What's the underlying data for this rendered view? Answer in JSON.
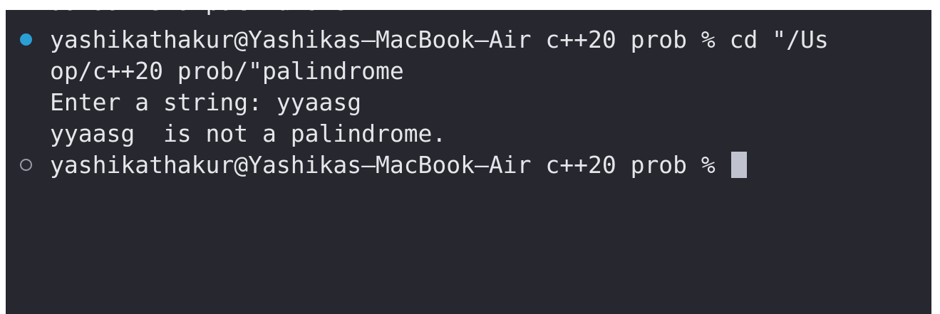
{
  "terminal": {
    "colors": {
      "background": "#272730",
      "text": "#e6e6ea",
      "success_dot": "#2a9fd6",
      "pending_dot": "#9a9aa6",
      "cursor": "#c0c3cf"
    },
    "partial_line": "aaiaa is a palindrome.",
    "lines": [
      {
        "status_icon": "filled-circle-icon",
        "text": "yashikathakur@Yashikas–MacBook–Air c++20 prob % cd \"/Us"
      },
      {
        "text": "op/c++20 prob/\"palindrome"
      },
      {
        "text": "Enter a string: yyaasg"
      },
      {
        "text": "yyaasg  is not a palindrome."
      },
      {
        "status_icon": "hollow-circle-icon",
        "text": "yashikathakur@Yashikas–MacBook–Air c++20 prob % "
      }
    ]
  }
}
